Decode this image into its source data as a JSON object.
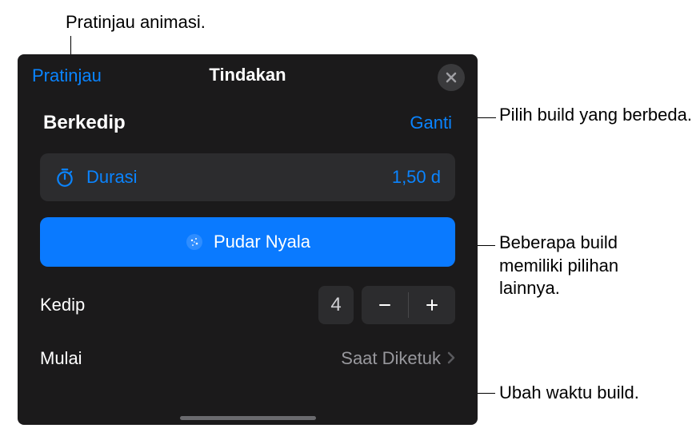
{
  "callouts": {
    "preview": "Pratinjau animasi.",
    "change": "Pilih build yang berbeda.",
    "effect": "Beberapa build memiliki pilihan lainnya.",
    "start": "Ubah waktu build."
  },
  "panel": {
    "preview_link": "Pratinjau",
    "title": "Tindakan",
    "build": {
      "name": "Berkedip",
      "change_label": "Ganti"
    },
    "duration": {
      "label": "Durasi",
      "value": "1,50 d"
    },
    "effect": {
      "label": "Pudar Nyala"
    },
    "stepper": {
      "label": "Kedip",
      "value": "4"
    },
    "start": {
      "label": "Mulai",
      "value": "Saat Diketuk"
    }
  }
}
